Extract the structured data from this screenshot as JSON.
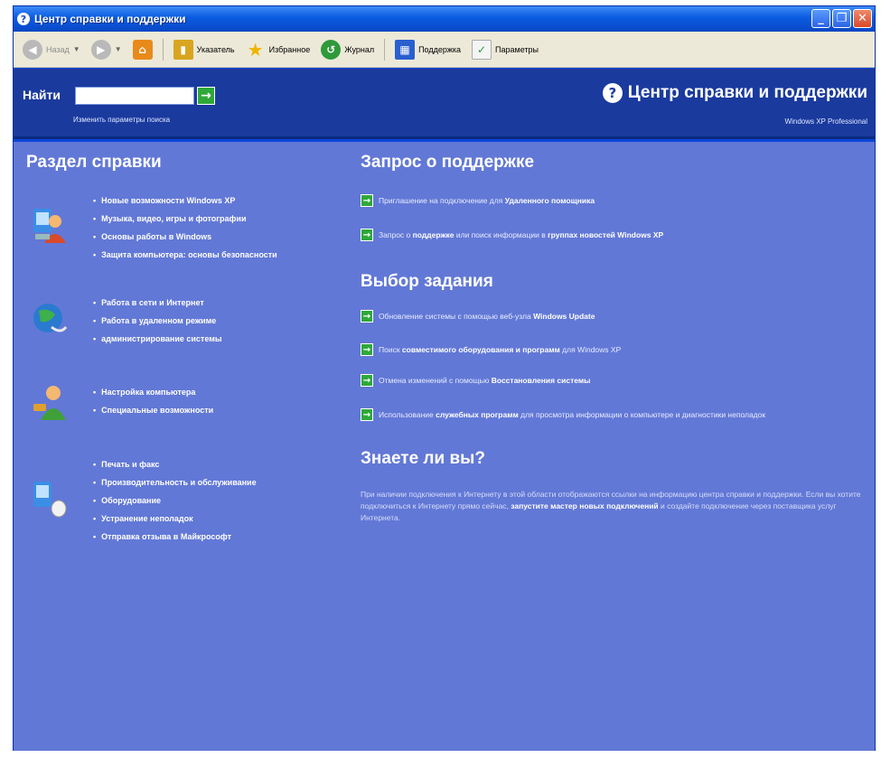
{
  "window": {
    "title": "Центр справки и поддержки",
    "controls": [
      "minimize",
      "maximize",
      "close"
    ]
  },
  "toolbar": {
    "back": "Назад",
    "index": "Указатель",
    "favorites": "Избранное",
    "history": "Журнал",
    "support": "Поддержка",
    "options": "Параметры"
  },
  "search": {
    "label": "Найти",
    "value": "",
    "change_params": "Изменить параметры поиска"
  },
  "brand": {
    "title": "Центр справки и поддержки",
    "subtitle": "Windows XP Professional"
  },
  "help_sections": {
    "heading": "Раздел справки",
    "groups": [
      {
        "icon": "user-computer-icon",
        "items": [
          "Новые возможности Windows XP",
          "Музыка, видео, игры и фотографии",
          "Основы работы в Windows",
          "Защита компьютера: основы безопасности"
        ]
      },
      {
        "icon": "globe-network-icon",
        "items": [
          "Работа в сети и Интернет",
          "Работа в удаленном режиме",
          "администрирование системы"
        ]
      },
      {
        "icon": "person-settings-icon",
        "items": [
          "Настройка компьютера",
          "Специальные возможности"
        ]
      },
      {
        "icon": "computer-mouse-icon",
        "items": [
          "Печать и факс",
          "Производительность и обслуживание",
          "Оборудование",
          "Устранение неполадок",
          "Отправка отзыва в Майкрософт"
        ]
      }
    ]
  },
  "support_request": {
    "heading": "Запрос о поддержке",
    "items": [
      {
        "pre": "Приглашение на подключение для ",
        "bold": "Удаленного помощника",
        "post": ""
      },
      {
        "pre": "Запрос о ",
        "bold": "поддержке",
        "mid": " или поиск информации в ",
        "bold2": "группах новостей Windows XP",
        "post": ""
      }
    ]
  },
  "tasks": {
    "heading": "Выбор задания",
    "items": [
      {
        "pre": "Обновление системы с помощью веб-узла ",
        "bold": "Windows Update",
        "post": ""
      },
      {
        "pre": "Поиск ",
        "bold": "совместимого оборудования и программ",
        "post": " для Windows XP"
      },
      {
        "pre": "Отмена изменений с помощью ",
        "bold": "Восстановления системы",
        "post": ""
      },
      {
        "pre": "Использование ",
        "bold": "служебных программ",
        "post": " для просмотра информации о компьютере и диагностики неполадок"
      }
    ]
  },
  "did_you_know": {
    "heading": "Знаете ли вы?",
    "text1": "При наличии подключения к Интернету в этой области отображаются ссылки на информацию центра справки и поддержки. Если вы хотите подключиться к Интернету прямо сейчас, ",
    "link": "запустите мастер новых подключений",
    "text2": " и создайте подключение через поставщика услуг Интернета."
  }
}
